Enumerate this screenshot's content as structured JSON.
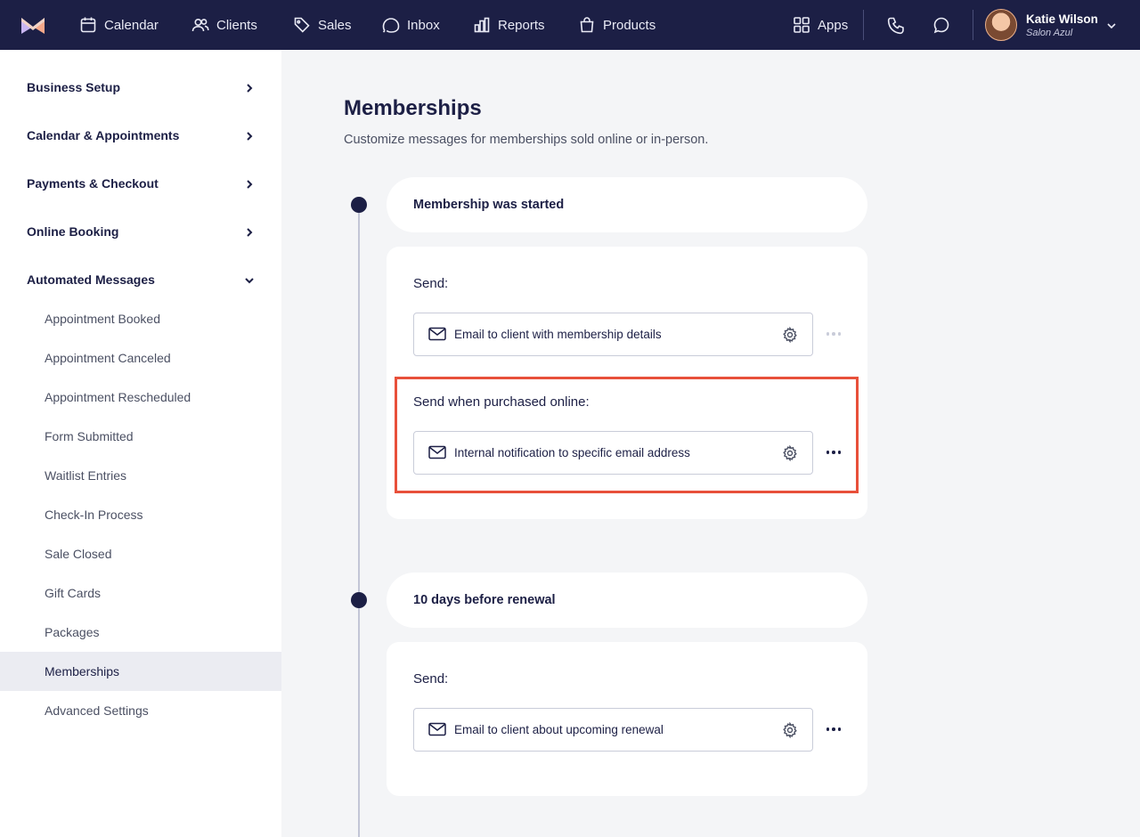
{
  "topnav": {
    "items": [
      {
        "label": "Calendar",
        "icon": "calendar-icon"
      },
      {
        "label": "Clients",
        "icon": "users-icon"
      },
      {
        "label": "Sales",
        "icon": "tag-icon"
      },
      {
        "label": "Inbox",
        "icon": "inbox-icon"
      },
      {
        "label": "Reports",
        "icon": "bar-chart-icon"
      },
      {
        "label": "Products",
        "icon": "shopping-bag-icon"
      }
    ],
    "apps_label": "Apps",
    "user": {
      "name": "Katie Wilson",
      "salon": "Salon Azul"
    }
  },
  "sidebar": {
    "sections": [
      {
        "label": "Business Setup",
        "expanded": false
      },
      {
        "label": "Calendar & Appointments",
        "expanded": false
      },
      {
        "label": "Payments & Checkout",
        "expanded": false
      },
      {
        "label": "Online Booking",
        "expanded": false
      },
      {
        "label": "Automated Messages",
        "expanded": true
      }
    ],
    "sub_items": [
      {
        "label": "Appointment Booked"
      },
      {
        "label": "Appointment Canceled"
      },
      {
        "label": "Appointment Rescheduled"
      },
      {
        "label": "Form Submitted"
      },
      {
        "label": "Waitlist Entries"
      },
      {
        "label": "Check-In Process"
      },
      {
        "label": "Sale Closed"
      },
      {
        "label": "Gift Cards"
      },
      {
        "label": "Packages"
      },
      {
        "label": "Memberships",
        "active": true
      },
      {
        "label": "Advanced Settings"
      }
    ]
  },
  "main": {
    "title": "Memberships",
    "subtitle": "Customize messages for memberships sold online or in-person.",
    "triggers": [
      {
        "title": "Membership was started",
        "groups": [
          {
            "label": "Send:",
            "message": "Email to client with membership details"
          },
          {
            "label": "Send when purchased online:",
            "message": "Internal notification to specific email address",
            "highlighted": true
          }
        ]
      },
      {
        "title": "10 days before renewal",
        "groups": [
          {
            "label": "Send:",
            "message": "Email to client about upcoming renewal"
          }
        ]
      }
    ]
  },
  "colors": {
    "nav_bg": "#1c1f45",
    "page_bg": "#f4f5f7",
    "highlight": "#e8503a",
    "active_item_bg": "#ebecf2"
  }
}
